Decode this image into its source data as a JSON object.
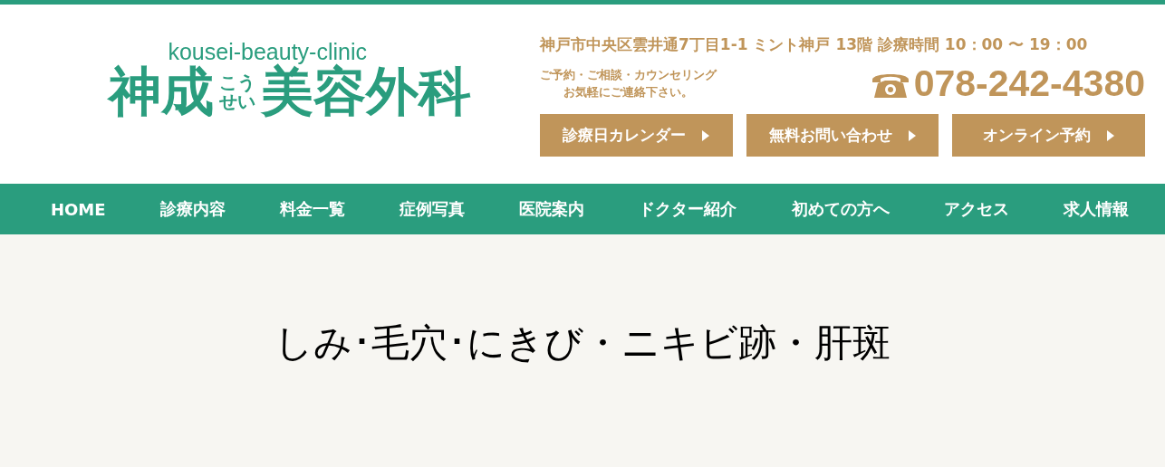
{
  "logo": {
    "subtitle": "kousei-beauty-clinic",
    "name_start": "神成",
    "reading": [
      "こう",
      "せい"
    ],
    "name_end": "美容外科"
  },
  "address": "神戸市中央区雲井通7丁目1-1 ミント神戸 13階 診療時間 10：00 〜 19：00",
  "contact_note": [
    "ご予約・ご相談・カウンセリング",
    "お気軽にご連絡下さい。"
  ],
  "phone": "078-242-4380",
  "buttons": [
    "診療日カレンダー",
    "無料お問い合わせ",
    "オンライン予約"
  ],
  "nav": [
    "HOME",
    "診療内容",
    "料金一覧",
    "症例写真",
    "医院案内",
    "ドクター紹介",
    "初めての方へ",
    "アクセス",
    "求人情報"
  ],
  "page_title": "しみ･毛穴･にきび・ニキビ跡・肝斑"
}
